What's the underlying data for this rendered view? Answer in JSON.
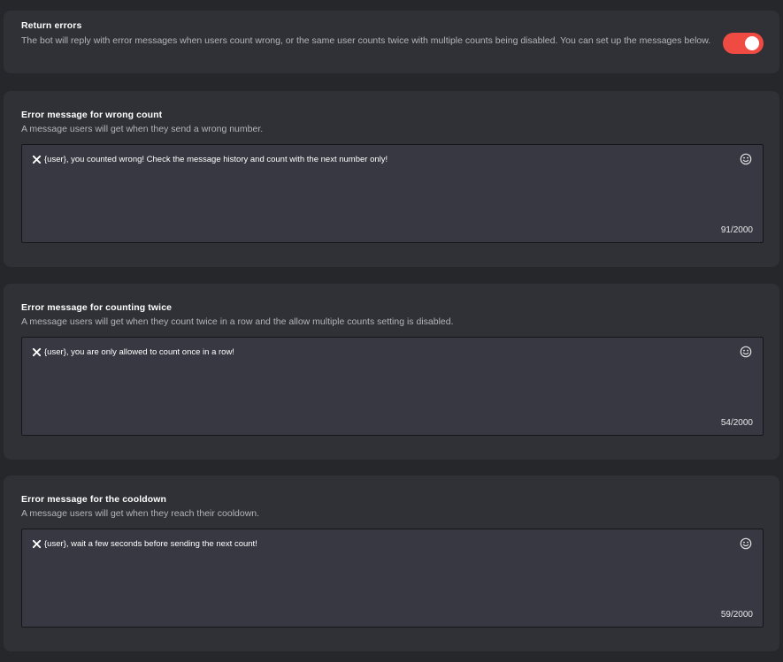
{
  "return_errors": {
    "title": "Return errors",
    "description": "The bot will reply with error messages when users count wrong, or the same user counts twice with multiple counts being disabled. You can set up the messages below.",
    "toggle_on": true,
    "toggle_color": "#f04b43"
  },
  "messages": [
    {
      "title": "Error message for wrong count",
      "description": "A message users will get when they send a wrong number.",
      "icon": "x-icon",
      "text": "{user}, you counted wrong! Check the message history and count with the next number only!",
      "counter": "91/2000"
    },
    {
      "title": "Error message for counting twice",
      "description": "A message users will get when they count twice in a row and the allow multiple counts setting is disabled.",
      "icon": "x-icon",
      "text": "{user}, you are only allowed to count once in a row!",
      "counter": "54/2000"
    },
    {
      "title": "Error message for the cooldown",
      "description": "A message users will get when they reach their cooldown.",
      "icon": "x-icon",
      "text": "{user}, wait a few seconds before sending the next count!",
      "counter": "59/2000"
    }
  ]
}
